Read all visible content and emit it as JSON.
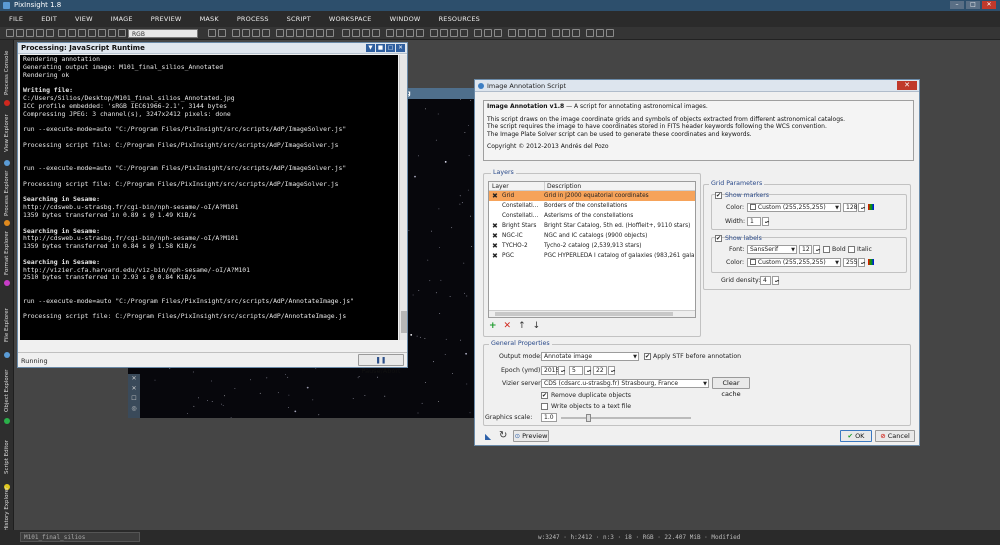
{
  "window": {
    "title": "PixInsight 1.8"
  },
  "menu": [
    "FILE",
    "EDIT",
    "VIEW",
    "IMAGE",
    "PREVIEW",
    "MASK",
    "PROCESS",
    "SCRIPT",
    "WORKSPACE",
    "WINDOW",
    "RESOURCES"
  ],
  "toolbar": {
    "colorspace": "RGB"
  },
  "left_tabs": [
    "Process Console",
    "View Explorer",
    "Process Explorer",
    "Format Explorer",
    "File Explorer",
    "Object Explorer",
    "Script Editor",
    "History Explorer"
  ],
  "image_window": {
    "title_fragment": "ong"
  },
  "console": {
    "title": "Processing: JavaScript Runtime",
    "lines": [
      {
        "t": "Rendering annotation",
        "b": false
      },
      {
        "t": "Generating output image: M101_final_silios_Annotated",
        "b": false
      },
      {
        "t": "Rendering ok",
        "b": false
      },
      {
        "t": "",
        "b": false
      },
      {
        "t": "Writing file:",
        "b": true
      },
      {
        "t": "C:/Users/Silios/Desktop/M101_final_silios_Annotated.jpg",
        "b": false
      },
      {
        "t": "ICC profile embedded: 'sRGB IEC61966-2.1', 3144 bytes",
        "b": false
      },
      {
        "t": "Compressing JPEG: 3 channel(s), 3247x2412 pixels: done",
        "b": false
      },
      {
        "t": "",
        "b": false
      },
      {
        "t": "run --execute-mode=auto \"C:/Program Files/PixInsight/src/scripts/AdP/ImageSolver.js\"",
        "b": false
      },
      {
        "t": "",
        "b": false
      },
      {
        "t": "Processing script file: C:/Program Files/PixInsight/src/scripts/AdP/ImageSolver.js",
        "b": false
      },
      {
        "t": "",
        "b": false
      },
      {
        "t": "",
        "b": false
      },
      {
        "t": "run --execute-mode=auto \"C:/Program Files/PixInsight/src/scripts/AdP/ImageSolver.js\"",
        "b": false
      },
      {
        "t": "",
        "b": false
      },
      {
        "t": "Processing script file: C:/Program Files/PixInsight/src/scripts/AdP/ImageSolver.js",
        "b": false
      },
      {
        "t": "",
        "b": false
      },
      {
        "t": "Searching in Sesame:",
        "b": true
      },
      {
        "t": "http://cdsweb.u-strasbg.fr/cgi-bin/nph-sesame/-oI/A?M101",
        "b": false
      },
      {
        "t": "1359 bytes transferred in 0.89 s @ 1.49 KiB/s",
        "b": false
      },
      {
        "t": "",
        "b": false
      },
      {
        "t": "Searching in Sesame:",
        "b": true
      },
      {
        "t": "http://cdsweb.u-strasbg.fr/cgi-bin/nph-sesame/-oI/A?M101",
        "b": false
      },
      {
        "t": "1359 bytes transferred in 0.84 s @ 1.58 KiB/s",
        "b": false
      },
      {
        "t": "",
        "b": false
      },
      {
        "t": "Searching in Sesame:",
        "b": true
      },
      {
        "t": "http://vizier.cfa.harvard.edu/viz-bin/nph-sesame/-oI/A?M101",
        "b": false
      },
      {
        "t": "2510 bytes transferred in 2.93 s @ 0.84 KiB/s",
        "b": false
      },
      {
        "t": "",
        "b": false
      },
      {
        "t": "",
        "b": false
      },
      {
        "t": "run --execute-mode=auto \"C:/Program Files/PixInsight/src/scripts/AdP/AnnotateImage.js\"",
        "b": false
      },
      {
        "t": "",
        "b": false
      },
      {
        "t": "Processing script file: C:/Program Files/PixInsight/src/scripts/AdP/AnnotateImage.js",
        "b": false
      }
    ],
    "status": "Running",
    "pause_label": "Pause/Abort"
  },
  "dialog": {
    "title": "Image Annotation Script",
    "info_title": "Image Annotation v1.8",
    "info_title_rest": " — A script for annotating astronomical images.",
    "info_p1": "This script draws on the image coordinate grids and symbols of objects extracted from different astronomical catalogs.",
    "info_p2": "The script requires the image to have coordinates stored in FITS header keywords following the WCS convention.",
    "info_p3": "The Image Plate Solver script can be used to generate these coordinates and keywords.",
    "copyright": "Copyright © 2012-2013 Andrés del Pozo",
    "layers_label": "Layers",
    "col_layer": "Layer",
    "col_desc": "Description",
    "layers": [
      {
        "name": "Grid",
        "desc": "Grid in J2000 equatorial coordinates",
        "checked": true,
        "selected": true
      },
      {
        "name": "Constellati...",
        "desc": "Borders of the constellations",
        "checked": false,
        "selected": false
      },
      {
        "name": "Constellati...",
        "desc": "Asterisms of the constellations",
        "checked": false,
        "selected": false
      },
      {
        "name": "Bright Stars",
        "desc": "Bright Star Catalog, 5th ed. (Hoffleit+, 9110 stars)",
        "checked": true,
        "selected": false
      },
      {
        "name": "NGC-IC",
        "desc": "NGC and IC catalogs (9900 objects)",
        "checked": true,
        "selected": false
      },
      {
        "name": "TYCHO-2",
        "desc": "Tycho-2 catalog (2,539,913 stars)",
        "checked": true,
        "selected": false
      },
      {
        "name": "PGC",
        "desc": "PGC HYPERLEDA I catalog of galaxies (983,261 galaxi...",
        "checked": true,
        "selected": false
      }
    ],
    "grid_params_label": "Grid Parameters",
    "show_markers": "Show markers",
    "color_label": "Color:",
    "marker_color": "Custom (255,255,255)",
    "marker_alpha": "128",
    "width_label": "Width:",
    "width_value": "1",
    "show_labels": "Show labels",
    "font_label": "Font:",
    "font_value": "SansSerif",
    "font_size": "12",
    "bold_label": "Bold",
    "italic_label": "Italic",
    "label_color": "Custom (255,255,255)",
    "label_alpha": "255",
    "grid_density_label": "Grid density:",
    "grid_density": "4",
    "general_label": "General Properties",
    "output_mode_label": "Output mode:",
    "output_mode": "Annotate image",
    "apply_stf": "Apply STF before annotation",
    "epoch_label": "Epoch (ymd):",
    "epoch_y": "2015",
    "epoch_m": "5",
    "epoch_d": "22",
    "vizier_label": "Vizier server:",
    "vizier_value": "CDS (cdsarc.u-strasbg.fr) Strasbourg, France",
    "clear_cache": "Clear cache",
    "remove_dup": "Remove duplicate objects",
    "write_objects": "Write objects to a text file",
    "graphics_scale_label": "Graphics scale:",
    "graphics_scale": "1.0",
    "graphics_scale_fraction": 0.2,
    "preview_label": "Preview",
    "ok_label": "OK",
    "cancel_label": "Cancel"
  },
  "status_bar": {
    "view": "M101_final_silios",
    "info": "w:3247 · h:2412 · n:3 · i8 · RGB · 22.407 MiB · Modified"
  }
}
